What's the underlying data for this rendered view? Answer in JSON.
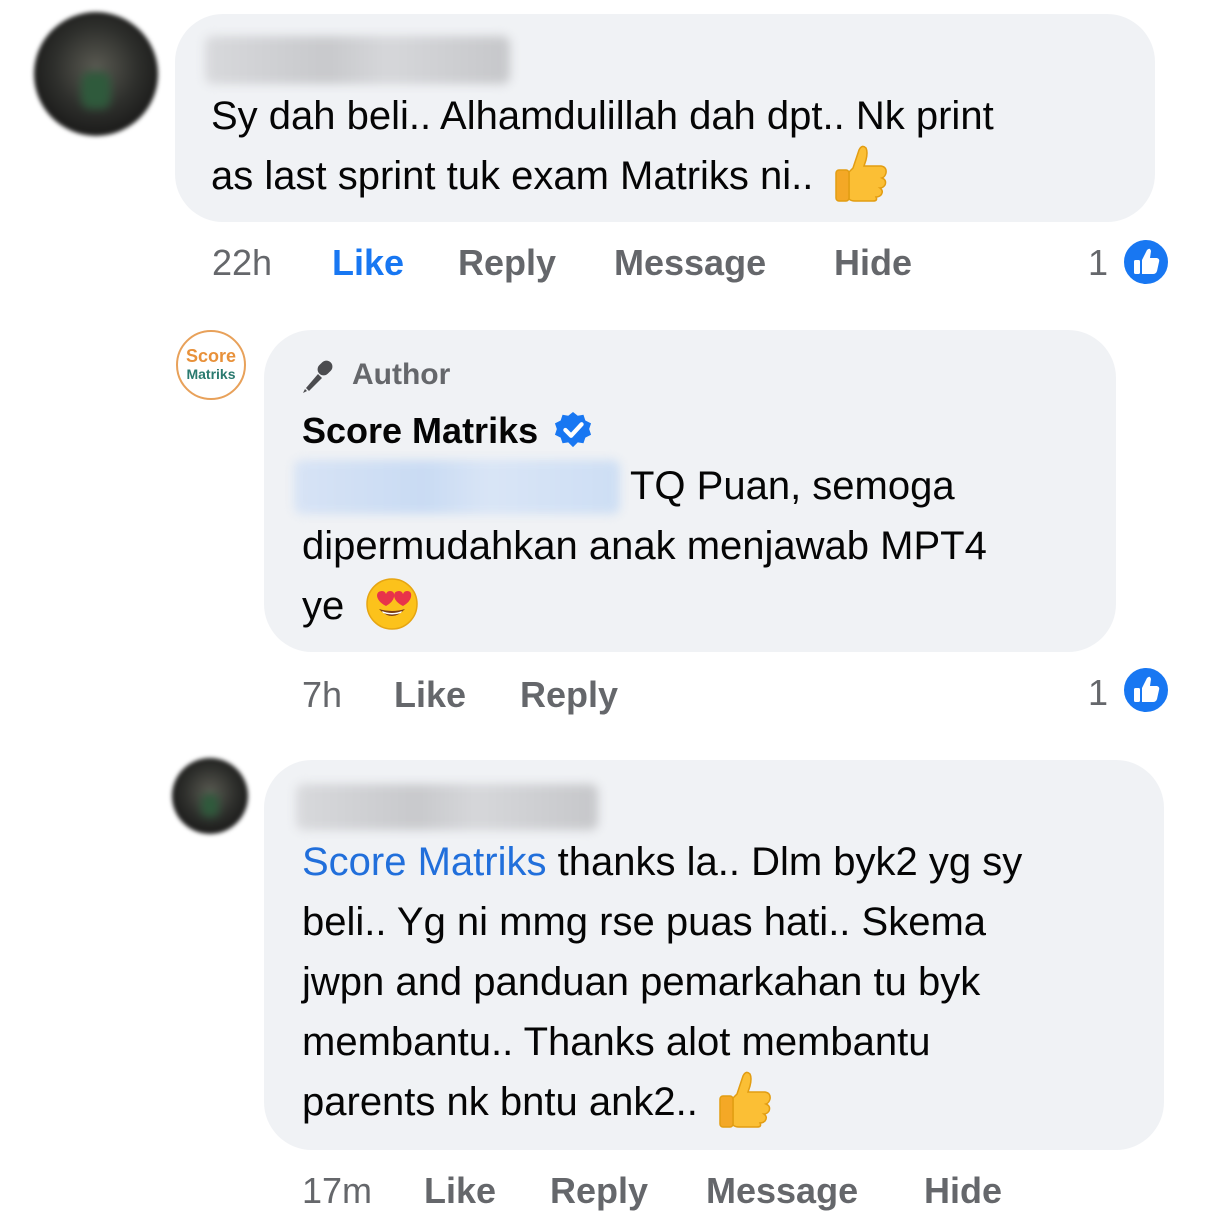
{
  "comments": [
    {
      "text_lines": [
        "Sy dah beli.. Alhamdulillah dah dpt.. Nk print",
        "as last sprint tuk exam Matriks ni.."
      ],
      "emoji": "thumbs-up",
      "time": "22h",
      "actions": [
        "Like",
        "Reply",
        "Message",
        "Hide"
      ],
      "reaction_count": "1"
    },
    {
      "badge": "Author",
      "author_name": "Score Matriks",
      "avatar_line1": "Score",
      "avatar_line2": "Matriks",
      "text_line1": "TQ Puan, semoga",
      "text_line2": "dipermudahkan anak menjawab MPT4",
      "text_line3": "ye",
      "emoji": "heart-eyes",
      "time": "7h",
      "actions": [
        "Like",
        "Reply"
      ],
      "reaction_count": "1"
    },
    {
      "mention": "Score Matriks",
      "text_line1": "thanks la.. Dlm byk2 yg sy",
      "text_lines": [
        "beli.. Yg ni mmg rse puas hati.. Skema",
        "jwpn and panduan pemarkahan tu byk",
        "membantu.. Thanks alot membantu",
        "parents nk bntu ank2.."
      ],
      "emoji": "thumbs-up",
      "time": "17m",
      "actions": [
        "Like",
        "Reply",
        "Message",
        "Hide"
      ]
    }
  ],
  "colors": {
    "accent": "#1877f2",
    "bubble": "#f0f2f5",
    "meta": "#65676b",
    "brand_orange": "#e8913a",
    "brand_teal": "#2a7a6f"
  }
}
